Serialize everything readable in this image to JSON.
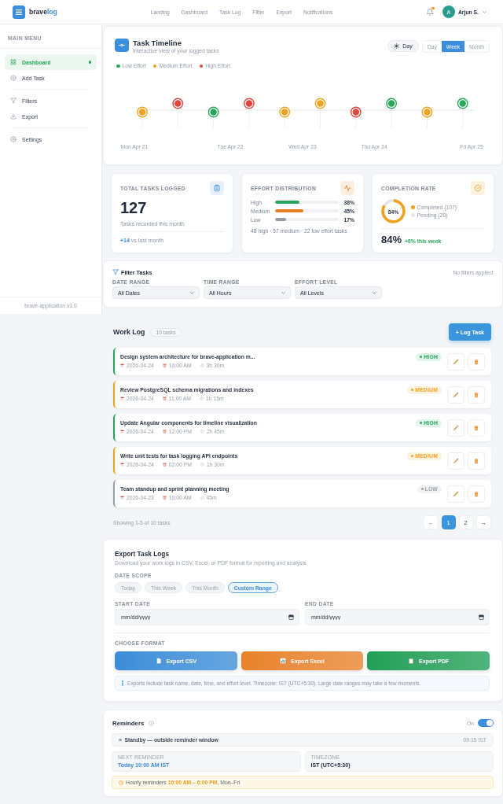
{
  "header": {
    "brand": "brave",
    "brand_accent": "log",
    "nav": [
      "Landing",
      "Dashboard",
      "Task Log",
      "Filter",
      "Export",
      "Notifications"
    ],
    "notifications": {
      "unread": true
    },
    "user": {
      "initial": "A",
      "name": "Arjun S."
    }
  },
  "sidebar": {
    "heading": "MAIN MENU",
    "groups": [
      {
        "items": [
          {
            "label": "Dashboard",
            "selected": true
          },
          {
            "label": "Add Task",
            "selected": false
          }
        ]
      },
      {
        "items": [
          {
            "label": "Filters",
            "selected": false
          },
          {
            "label": "Export",
            "selected": false
          }
        ]
      },
      {
        "items": [
          {
            "label": "Settings",
            "selected": false
          }
        ]
      }
    ],
    "footer": "brave-application v1.0"
  },
  "timeline": {
    "title": "Task Timeline",
    "subtitle": "Interactive view of your logged tasks",
    "theme_toggle": {
      "label": "Day"
    },
    "views": [
      {
        "label": "Day",
        "selected": false
      },
      {
        "label": "Week",
        "selected": true
      },
      {
        "label": "Month",
        "selected": false
      }
    ],
    "legend": [
      {
        "label": "Low Effort",
        "color": "#27a65a"
      },
      {
        "label": "Medium Effort",
        "color": "#f2a21e"
      },
      {
        "label": "High Effort",
        "color": "#e0473d"
      }
    ],
    "events": [
      {
        "color": "#f2a21e"
      },
      {
        "color": "#e0473d"
      },
      {
        "color": "#27a65a"
      },
      {
        "color": "#e0473d"
      },
      {
        "color": "#f2a21e"
      },
      {
        "color": "#f2a21e"
      },
      {
        "color": "#e0473d"
      },
      {
        "color": "#27a65a"
      },
      {
        "color": "#f2a21e"
      },
      {
        "color": "#27a65a"
      }
    ],
    "dates": [
      "Mon Apr 21",
      "Tue Apr 22",
      "Wed Apr 23",
      "Thu Apr 24",
      "Fri Apr 25"
    ]
  },
  "stats": [
    {
      "kind": "total",
      "title": "TOTAL TASKS LOGGED",
      "value": "127",
      "caption": "Tasks recorded this month",
      "trend": "**+14** vs last month"
    },
    {
      "kind": "distribution",
      "title": "EFFORT DISTRIBUTION",
      "rows": [
        {
          "label": "High",
          "level": 0.38,
          "reading": "38%",
          "color": "#27a65a"
        },
        {
          "label": "Medium",
          "level": 0.45,
          "reading": "45%",
          "color": "#e67e22"
        },
        {
          "label": "Low",
          "level": 0.17,
          "reading": "17%",
          "color": "#959ba3"
        }
      ],
      "summary": "48 high · 57 medium · 22 low effort tasks"
    },
    {
      "kind": "completion",
      "title": "COMPLETION RATE",
      "chart_data": {
        "type": "donut",
        "values": [
          84,
          16
        ]
      },
      "center_label": "84%",
      "legend": [
        {
          "label": "Completed (107)",
          "color": "#f0a020"
        },
        {
          "label": "Pending (20)",
          "color": "#e3e6ea"
        }
      ],
      "value": "84%",
      "trend": "+6% this week"
    }
  ],
  "filters": {
    "title": "Filter Tasks",
    "status": "No filters applied",
    "fields": [
      {
        "label": "DATE RANGE",
        "value": "All Dates"
      },
      {
        "label": "TIME RANGE",
        "value": "All Hours"
      },
      {
        "label": "EFFORT LEVEL",
        "value": "All Levels"
      }
    ]
  },
  "work_log": {
    "title": "Work Log",
    "count": "10 tasks",
    "add_button": "+ Log Task",
    "tasks": [
      {
        "title": "Design system architecture for brave-application m...",
        "date": "2026-04-24",
        "time": "10:00 AM",
        "duration": "3h 30m",
        "effort": "HIGH",
        "color": "#27a65a"
      },
      {
        "title": "Review PostgreSQL schema migrations and indexes",
        "date": "2026-04-24",
        "time": "11:00 AM",
        "duration": "1h 15m",
        "effort": "MEDIUM",
        "color": "#f2a21e"
      },
      {
        "title": "Update Angular components for timeline visualization",
        "date": "2026-04-24",
        "time": "12:00 PM",
        "duration": "2h 45m",
        "effort": "HIGH",
        "color": "#27a65a"
      },
      {
        "title": "Write unit tests for task logging API endpoints",
        "date": "2026-04-24",
        "time": "02:00 PM",
        "duration": "1h 30m",
        "effort": "MEDIUM",
        "color": "#f2a21e"
      },
      {
        "title": "Team standup and sprint planning meeting",
        "date": "2026-04-23",
        "time": "10:00 AM",
        "duration": "45m",
        "effort": "LOW",
        "color": "#9aa1a9"
      }
    ],
    "summary": "Showing 1-5 of 10 tasks",
    "pagination": {
      "prev": {
        "label": "←",
        "disabled": true
      },
      "pages": [
        {
          "label": "1",
          "selected": true
        },
        {
          "label": "2",
          "selected": false
        }
      ],
      "next": {
        "label": "→",
        "disabled": false
      }
    }
  },
  "export": {
    "title": "Export Task Logs",
    "subtitle": "Download your work logs in CSV, Excel, or PDF format for reporting and analysis.",
    "scope_label": "DATE SCOPE",
    "scopes": [
      {
        "label": "Today",
        "selected": false
      },
      {
        "label": "This Week",
        "selected": false
      },
      {
        "label": "This Month",
        "selected": false
      },
      {
        "label": "Custom Range",
        "selected": true
      }
    ],
    "dates": [
      {
        "label": "START DATE",
        "placeholder": "mm/dd/yyyy"
      },
      {
        "label": "END DATE",
        "placeholder": "mm/dd/yyyy"
      }
    ],
    "format_label": "CHOOSE FORMAT",
    "formats": [
      {
        "label": "Export CSV",
        "color": "#3a8dd8"
      },
      {
        "label": "Export Excel",
        "color": "#e8822a"
      },
      {
        "label": "Export PDF",
        "color": "#1f9f56"
      }
    ],
    "note": "Exports include task name, date, time, and effort level. Timezone: IST (UTC+5:30). Large date ranges may take a few moments."
  },
  "reminders": {
    "title": "Reminders",
    "toggle": {
      "label": "On",
      "on": true
    },
    "status": {
      "text": "Standby — outside reminder window",
      "time": "09:15 IST",
      "active": false
    },
    "cards": [
      {
        "label": "NEXT REMINDER",
        "value": "Today 10:00 AM IST",
        "kind": "highlight"
      },
      {
        "label": "TIMEZONE",
        "value": "IST (UTC+5:30)",
        "kind": "plain"
      }
    ],
    "schedule": "Hourly reminders **10:00 AM – 6:00 PM**, Mon–Fri"
  }
}
